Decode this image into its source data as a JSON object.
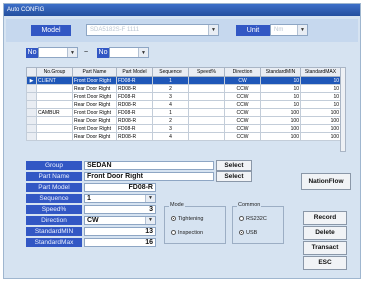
{
  "window": {
    "title": "Auto CONFIG"
  },
  "top": {
    "model_label": "Model",
    "model_value": "SDA5182S-F 1111",
    "unit_label": "Unit",
    "unit_value": "Nm"
  },
  "filter": {
    "no_label_1": "No",
    "tilde": "~",
    "no_label_2": "No"
  },
  "grid": {
    "columns": [
      "",
      "No.Group",
      "Part Name",
      "Part Model",
      "Sequence",
      "Speed%",
      "Direction",
      "StandardMIN",
      "StandardMAX"
    ],
    "rows": [
      {
        "marker": "▶",
        "group": "CLIENT",
        "part_name": "Front Door Right",
        "part_model": "FD08-R",
        "seq": "1",
        "dir": "CW",
        "min": "10",
        "max": "10"
      },
      {
        "marker": "",
        "group": "",
        "part_name": "Rear Door Right",
        "part_model": "RD08-R",
        "seq": "2",
        "dir": "CCW",
        "min": "10",
        "max": "10"
      },
      {
        "marker": "",
        "group": "",
        "part_name": "Front Door Right",
        "part_model": "FD08-R",
        "seq": "3",
        "dir": "CCW",
        "min": "10",
        "max": "10"
      },
      {
        "marker": "",
        "group": "",
        "part_name": "Rear Door Right",
        "part_model": "RD08-R",
        "seq": "4",
        "dir": "CCW",
        "min": "10",
        "max": "10"
      },
      {
        "marker": "",
        "group": "CAMBUR",
        "part_name": "Front Door Right",
        "part_model": "FD08-R",
        "seq": "1",
        "dir": "CCW",
        "min": "100",
        "max": "100"
      },
      {
        "marker": "",
        "group": "",
        "part_name": "Rear Door Right",
        "part_model": "RD08-R",
        "seq": "2",
        "dir": "CCW",
        "min": "100",
        "max": "100"
      },
      {
        "marker": "",
        "group": "",
        "part_name": "Front Door Right",
        "part_model": "FD08-R",
        "seq": "3",
        "dir": "CCW",
        "min": "100",
        "max": "100"
      },
      {
        "marker": "",
        "group": "",
        "part_name": "Rear Door Right",
        "part_model": "RD08-R",
        "seq": "4",
        "dir": "CCW",
        "min": "100",
        "max": "100"
      }
    ]
  },
  "form": {
    "group_label": "Group",
    "group_value": "SEDAN",
    "partname_label": "Part Name",
    "partname_value": "Front Door Right",
    "partmodel_label": "Part Model",
    "partmodel_value": "FD08-R",
    "sequence_label": "Sequence",
    "sequence_value": "1",
    "speed_label": "Speed%",
    "speed_value": "3",
    "direction_label": "Direction",
    "direction_value": "CW",
    "stdmin_label": "StandardMIN",
    "stdmin_value": "13",
    "stdmax_label": "StandardMax",
    "stdmax_value": "16",
    "select_label": "Select"
  },
  "mode": {
    "title": "Mode",
    "tightening": "Tightening",
    "inspection": "Inspection"
  },
  "common": {
    "title": "Common",
    "rs232": "RS232C",
    "usb": "USB"
  },
  "buttons": {
    "nation_flow": "NationFlow",
    "record": "Record",
    "delete": "Delete",
    "transact": "Transact",
    "esc": "ESC"
  }
}
